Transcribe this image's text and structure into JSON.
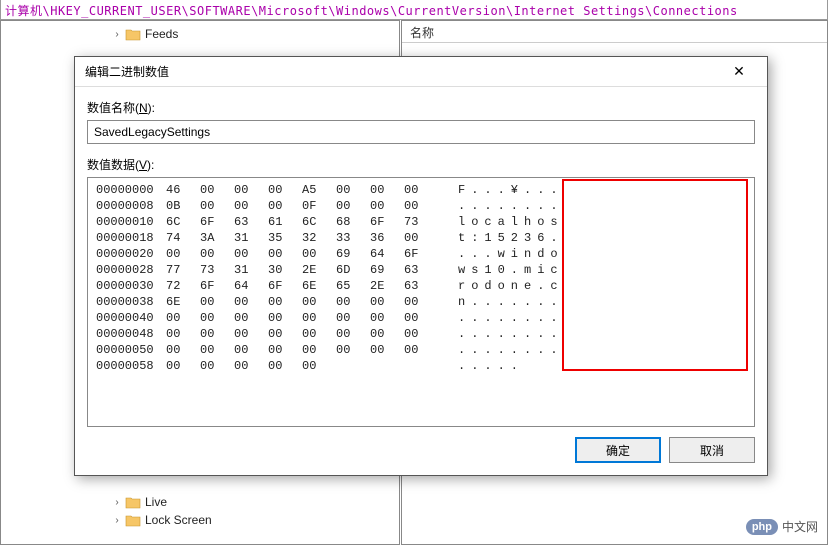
{
  "regpath": "计算机\\HKEY_CURRENT_USER\\SOFTWARE\\Microsoft\\Windows\\CurrentVersion\\Internet Settings\\Connections",
  "tree": {
    "top_items": [
      "Feeds"
    ],
    "bottom_items": [
      "Live",
      "Lock Screen"
    ]
  },
  "right_header": "名称",
  "dialog": {
    "title": "编辑二进制数值",
    "value_name_label_pre": "数值名称(",
    "value_name_label_key": "N",
    "value_name_label_post": "):",
    "value_name": "SavedLegacySettings",
    "value_data_label_pre": "数值数据(",
    "value_data_label_key": "V",
    "value_data_label_post": "):",
    "ok": "确定",
    "cancel": "取消"
  },
  "hex": {
    "rows": [
      {
        "off": "00000000",
        "b": [
          "46",
          "00",
          "00",
          "00",
          "A5",
          "00",
          "00",
          "00"
        ],
        "a": "F...¥..."
      },
      {
        "off": "00000008",
        "b": [
          "0B",
          "00",
          "00",
          "00",
          "0F",
          "00",
          "00",
          "00"
        ],
        "a": "........"
      },
      {
        "off": "00000010",
        "b": [
          "6C",
          "6F",
          "63",
          "61",
          "6C",
          "68",
          "6F",
          "73"
        ],
        "a": "localhos"
      },
      {
        "off": "00000018",
        "b": [
          "74",
          "3A",
          "31",
          "35",
          "32",
          "33",
          "36",
          "00"
        ],
        "a": "t:15236."
      },
      {
        "off": "00000020",
        "b": [
          "00",
          "00",
          "00",
          "00",
          "00",
          "69",
          "64",
          "6F"
        ],
        "a": "...windo"
      },
      {
        "off": "00000028",
        "b": [
          "77",
          "73",
          "31",
          "30",
          "2E",
          "6D",
          "69",
          "63"
        ],
        "a": "ws10.mic"
      },
      {
        "off": "00000030",
        "b": [
          "72",
          "6F",
          "64",
          "6F",
          "6E",
          "65",
          "2E",
          "63"
        ],
        "a": "rodone.c"
      },
      {
        "off": "00000038",
        "b": [
          "6E",
          "00",
          "00",
          "00",
          "00",
          "00",
          "00",
          "00"
        ],
        "a": "n......."
      },
      {
        "off": "00000040",
        "b": [
          "00",
          "00",
          "00",
          "00",
          "00",
          "00",
          "00",
          "00"
        ],
        "a": "........"
      },
      {
        "off": "00000048",
        "b": [
          "00",
          "00",
          "00",
          "00",
          "00",
          "00",
          "00",
          "00"
        ],
        "a": "........"
      },
      {
        "off": "00000050",
        "b": [
          "00",
          "00",
          "00",
          "00",
          "00",
          "00",
          "00",
          "00"
        ],
        "a": "........"
      },
      {
        "off": "00000058",
        "b": [
          "00",
          "00",
          "00",
          "00",
          "00"
        ],
        "a": "....."
      }
    ]
  },
  "watermark": {
    "badge": "php",
    "text": "中文网"
  }
}
